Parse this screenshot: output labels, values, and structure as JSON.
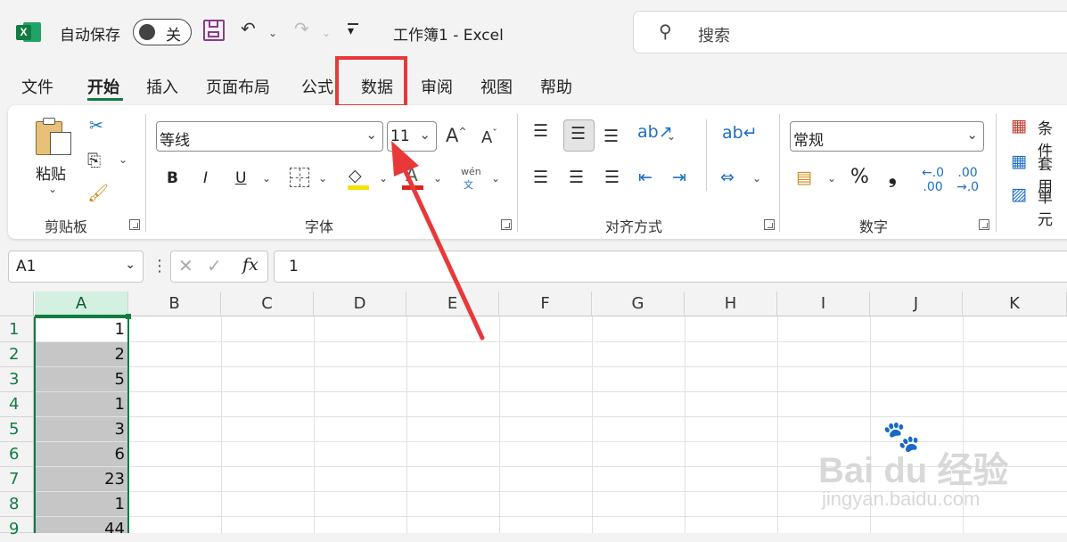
{
  "app": {
    "logo_letter": "X",
    "autosave_label": "自动保存",
    "autosave_state": "关",
    "title": "工作簿1  -  Excel",
    "search_placeholder": "搜索",
    "accent_color": "#107c41"
  },
  "tabs": [
    "文件",
    "开始",
    "插入",
    "页面布局",
    "公式",
    "数据",
    "审阅",
    "视图",
    "帮助"
  ],
  "active_tab": "开始",
  "highlighted_tab": "数据",
  "ribbon": {
    "clipboard": {
      "paste_label": "粘贴",
      "group_label": "剪贴板"
    },
    "font": {
      "font_name": "等线",
      "font_size": "11",
      "bold": "B",
      "italic": "I",
      "underline": "U",
      "phonetic_top": "wén",
      "phonetic_bottom": "文",
      "group_label": "字体"
    },
    "alignment": {
      "group_label": "对齐方式"
    },
    "number": {
      "format": "常规",
      "percent": "%",
      "comma": "❟",
      "group_label": "数字"
    },
    "styles": {
      "conditional": "条件",
      "table": "套用",
      "cell": "单元"
    }
  },
  "formula_bar": {
    "name_box": "A1",
    "fx": "fx",
    "value": "1"
  },
  "columns": [
    "A",
    "B",
    "C",
    "D",
    "E",
    "F",
    "G",
    "H",
    "I",
    "J",
    "K"
  ],
  "rows": [
    "1",
    "2",
    "3",
    "4",
    "5",
    "6",
    "7",
    "8",
    "9"
  ],
  "column_a_values": [
    "1",
    "2",
    "5",
    "1",
    "3",
    "6",
    "23",
    "1",
    "44"
  ],
  "watermark": {
    "brand": "Bai du 经验",
    "url": "jingyan.baidu.com"
  }
}
